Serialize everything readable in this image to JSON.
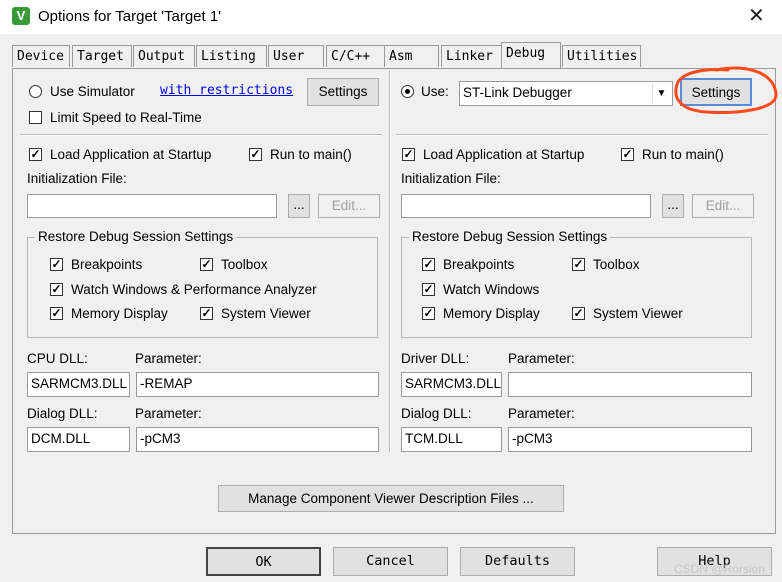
{
  "window": {
    "title": "Options for Target 'Target 1'",
    "close_glyph": "✕"
  },
  "tabs": [
    "Device",
    "Target",
    "Output",
    "Listing",
    "User",
    "C/C++",
    "Asm",
    "Linker",
    "Debug",
    "Utilities"
  ],
  "active_tab": "Debug",
  "left": {
    "use_simulator_label": "Use Simulator",
    "with_restrictions_link": "with restrictions",
    "settings_button": "Settings",
    "limit_speed_label": "Limit Speed to Real-Time",
    "load_app_label": "Load Application at Startup",
    "run_to_main_label": "Run to main()",
    "init_file_label": "Initialization File:",
    "init_file_value": "",
    "browse_button": "...",
    "edit_button": "Edit...",
    "restore_group_title": "Restore Debug Session Settings",
    "breakpoints_label": "Breakpoints",
    "toolbox_label": "Toolbox",
    "watch_label": "Watch Windows & Performance Analyzer",
    "memory_label": "Memory Display",
    "sysviewer_label": "System Viewer",
    "cpu_dll_label": "CPU DLL:",
    "param_label": "Parameter:",
    "cpu_dll_value": "SARMCM3.DLL",
    "cpu_param_value": "-REMAP",
    "dialog_dll_label": "Dialog DLL:",
    "dialog_param_label": "Parameter:",
    "dialog_dll_value": "DCM.DLL",
    "dialog_param_value": "-pCM3"
  },
  "right": {
    "use_label": "Use:",
    "debugger_value": "ST-Link Debugger",
    "settings_button": "Settings",
    "load_app_label": "Load Application at Startup",
    "run_to_main_label": "Run to main()",
    "init_file_label": "Initialization File:",
    "init_file_value": "",
    "browse_button": "...",
    "edit_button": "Edit...",
    "restore_group_title": "Restore Debug Session Settings",
    "breakpoints_label": "Breakpoints",
    "toolbox_label": "Toolbox",
    "watch_label": "Watch Windows",
    "memory_label": "Memory Display",
    "sysviewer_label": "System Viewer",
    "driver_dll_label": "Driver DLL:",
    "param_label": "Parameter:",
    "driver_dll_value": "SARMCM3.DLL",
    "driver_param_value": "",
    "dialog_dll_label": "Dialog DLL:",
    "dialog_param_label": "Parameter:",
    "dialog_dll_value": "TCM.DLL",
    "dialog_param_value": "-pCM3"
  },
  "manage_button": "Manage Component Viewer Description Files ...",
  "footer": {
    "ok": "OK",
    "cancel": "Cancel",
    "defaults": "Defaults",
    "help": "Help"
  },
  "watermark": "CSDN @Rorsion",
  "colors": {
    "annotation": "#ff4a1a",
    "link": "#0000ee"
  }
}
